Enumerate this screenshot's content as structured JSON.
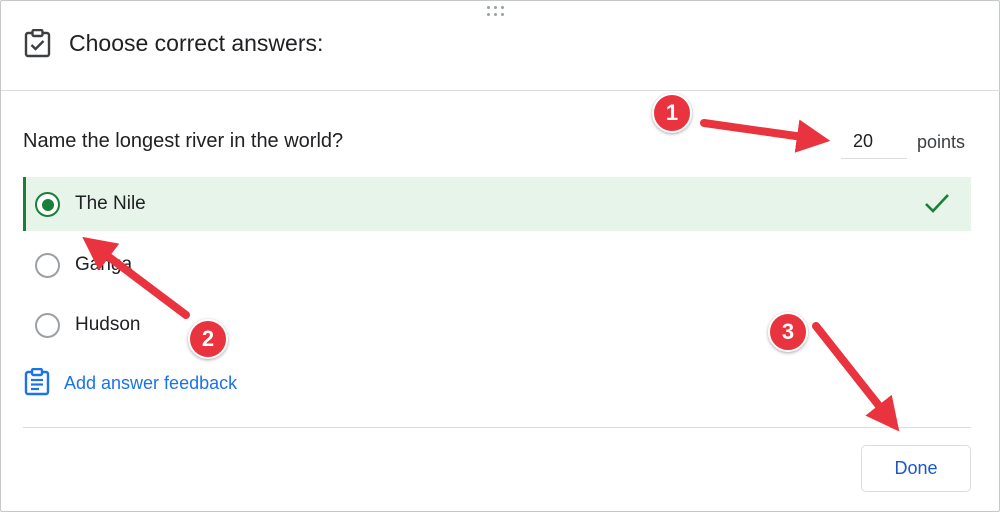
{
  "header": {
    "title": "Choose correct answers:",
    "icon": "assignment-check-icon"
  },
  "question": {
    "text": "Name the longest river in the world?",
    "points_value": "20",
    "points_label": "points"
  },
  "options": [
    {
      "label": "The Nile",
      "selected": true,
      "correct": true
    },
    {
      "label": "Ganga",
      "selected": false,
      "correct": false
    },
    {
      "label": "Hudson",
      "selected": false,
      "correct": false
    }
  ],
  "feedback": {
    "label": "Add answer feedback",
    "icon": "feedback-clipboard-icon"
  },
  "footer": {
    "done_label": "Done"
  },
  "annotations": {
    "badges": [
      "1",
      "2",
      "3"
    ],
    "color": "#e9333f"
  },
  "colors": {
    "correct_green": "#188038",
    "correct_bg": "#e6f4ea",
    "link_blue": "#1a73e8"
  }
}
